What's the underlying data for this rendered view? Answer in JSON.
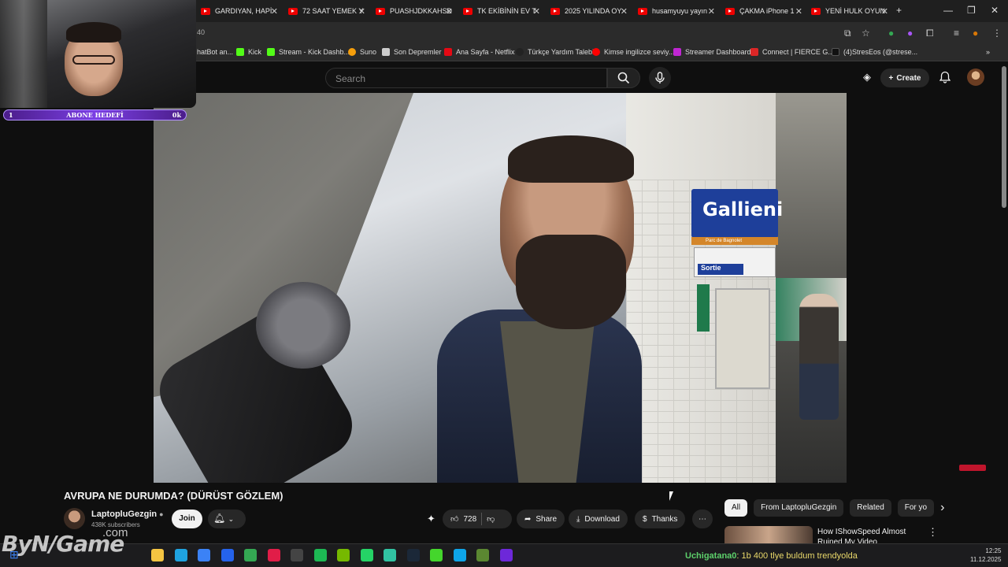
{
  "browser": {
    "tabs": [
      {
        "label": "GARDIYAN, HAPİ"
      },
      {
        "label": "72 SAAT YEMEK Y"
      },
      {
        "label": "PUASHJDKKAHSD"
      },
      {
        "label": "TK EKİBİNİN EV T"
      },
      {
        "label": "2025 YILINDA OY"
      },
      {
        "label": "husamyuyu yayın"
      },
      {
        "label": "ÇAKMA iPhone 1"
      },
      {
        "label": "YENİ HULK OYUN"
      }
    ],
    "new_tab": "+",
    "close_glyph": "✕",
    "window_controls": [
      "—",
      "❐",
      "✕"
    ],
    "address_text": "40",
    "bookmarks": [
      {
        "label": "hatBot an...",
        "color": "#888888"
      },
      {
        "label": "Kick",
        "color": "#53fc18"
      },
      {
        "label": "Stream - Kick Dashb...",
        "color": "#53fc18"
      },
      {
        "label": "Suno",
        "color": "#f59e0b"
      },
      {
        "label": "Son Depremler",
        "color": "#cccccc"
      },
      {
        "label": "Ana Sayfa - Netflix",
        "color": "#e50914"
      },
      {
        "label": "Türkçe Yardım Talebi",
        "color": "#222222"
      },
      {
        "label": "Kimse ingilizce seviy...",
        "color": "#ff0000"
      },
      {
        "label": "Streamer Dashboard",
        "color": "#c026d3"
      },
      {
        "label": "Connect | FIERCE G...",
        "color": "#dc2626"
      },
      {
        "label": "(4)StresEos (@strese...",
        "color": "#111111"
      }
    ],
    "bookmarks_more": "»"
  },
  "youtube_header": {
    "search_placeholder": "Search",
    "create_label": "Create",
    "create_plus": "+"
  },
  "overlay": {
    "abone_label": "ABONE HEDEFİ",
    "abone_left": "1",
    "abone_right": "0k",
    "watermark_logo": "ByN/Game",
    "watermark_domain": ".com"
  },
  "video_scene": {
    "station_sign": "Gallieni",
    "station_sub": "Parc de Bagnolet",
    "exit_sign": "Sortie"
  },
  "video_info": {
    "title": "AVRUPA NE DURUMDA? (DÜRÜST GÖZLEM)",
    "channel_name": "LaptopluGezgin",
    "subscribers": "438K subscribers",
    "join_label": "Join",
    "likes": "728",
    "share_label": "Share",
    "download_label": "Download",
    "thanks_label": "Thanks",
    "more": "⋯"
  },
  "sidebar": {
    "chips": [
      "All",
      "From LaptopluGezgin",
      "Related",
      "For yo"
    ],
    "next_chip": "›",
    "rec_title": "How IShowSpeed Almost Ruined My Video"
  },
  "taskbar": {
    "ticker_user": "Uchigatana0",
    "ticker_text": ": 1b 400 tlye buldum trendyolda",
    "time": "12:25",
    "date": "11.12.2025",
    "apps": [
      {
        "name": "file-explorer-icon",
        "color": "#f5c542"
      },
      {
        "name": "edge-icon",
        "color": "#1fa3e0"
      },
      {
        "name": "store-icon",
        "color": "#3b82f6"
      },
      {
        "name": "outlook-icon",
        "color": "#2563eb"
      },
      {
        "name": "chrome-icon",
        "color": "#34a853"
      },
      {
        "name": "opera-icon",
        "color": "#e11d48"
      },
      {
        "name": "obs-icon",
        "color": "#444444"
      },
      {
        "name": "spotify-icon",
        "color": "#1db954"
      },
      {
        "name": "nvidia-icon",
        "color": "#76b900"
      },
      {
        "name": "whatsapp-icon",
        "color": "#25d366"
      },
      {
        "name": "streamlabs-icon",
        "color": "#31c3a2"
      },
      {
        "name": "steam-icon",
        "color": "#1b2838"
      },
      {
        "name": "razer-icon",
        "color": "#44d62c"
      },
      {
        "name": "app-blue-icon",
        "color": "#0ea5e9"
      },
      {
        "name": "minecraft-icon",
        "color": "#5b8731"
      },
      {
        "name": "app-purple-icon",
        "color": "#6d28d9"
      }
    ]
  }
}
